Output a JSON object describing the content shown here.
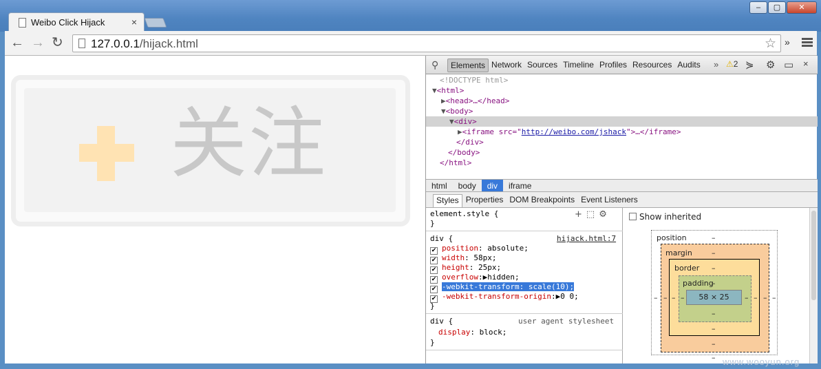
{
  "window": {
    "tab_title": "Weibo Click Hijack",
    "tab_close": "×",
    "minimize": "–",
    "maximize": "▢",
    "close": "✕"
  },
  "toolbar": {
    "back": "←",
    "forward": "→",
    "reload": "↻",
    "url_host": "127.0.0.1",
    "url_path": "/hijack.html",
    "star": "☆",
    "extensions": "»"
  },
  "page": {
    "follow_text": "关注"
  },
  "devtools": {
    "search_icon": "⚲",
    "tabs": [
      "Elements",
      "Network",
      "Sources",
      "Timeline",
      "Profiles",
      "Resources",
      "Audits"
    ],
    "more": "»",
    "warning_count": "2",
    "close": "×",
    "dom": {
      "doctype": "<!DOCTYPE html>",
      "html_open": "<html>",
      "head": "<head>…</head>",
      "body_open": "<body>",
      "div_open": "<div>",
      "iframe_pre": "<iframe src=\"",
      "iframe_url": "http://weibo.com/jshack",
      "iframe_post": "\">…</iframe>",
      "div_close": "</div>",
      "body_close": "</body>",
      "html_close": "</html>"
    },
    "breadcrumbs": [
      "html",
      "body",
      "div",
      "iframe"
    ],
    "subtabs": [
      "Styles",
      "Properties",
      "DOM Breakpoints",
      "Event Listeners"
    ],
    "styles": {
      "element_style_open": "element.style {",
      "close_brace": "}",
      "div_rule_open": "div {",
      "div_rule_source": "hijack.html:7",
      "props": [
        {
          "name": "position",
          "value": "absolute;"
        },
        {
          "name": "width",
          "value": "58px;"
        },
        {
          "name": "height",
          "value": "25px;"
        },
        {
          "name": "overflow",
          "value": "hidden;"
        },
        {
          "name": "-webkit-transform",
          "value": "scale(10);"
        },
        {
          "name": "-webkit-transform-origin",
          "value": "0 0;"
        }
      ],
      "ua_rule_open": "div {",
      "ua_rule_source": "user agent stylesheet",
      "ua_prop_name": "display",
      "ua_prop_value": "block;"
    },
    "metrics": {
      "show_inherited": "Show inherited",
      "position_label": "position",
      "margin_label": "margin",
      "border_label": "border",
      "padding_label": "padding",
      "dash": "–",
      "content_size": "58 × 25"
    }
  },
  "watermark": "www.wooyun.org"
}
